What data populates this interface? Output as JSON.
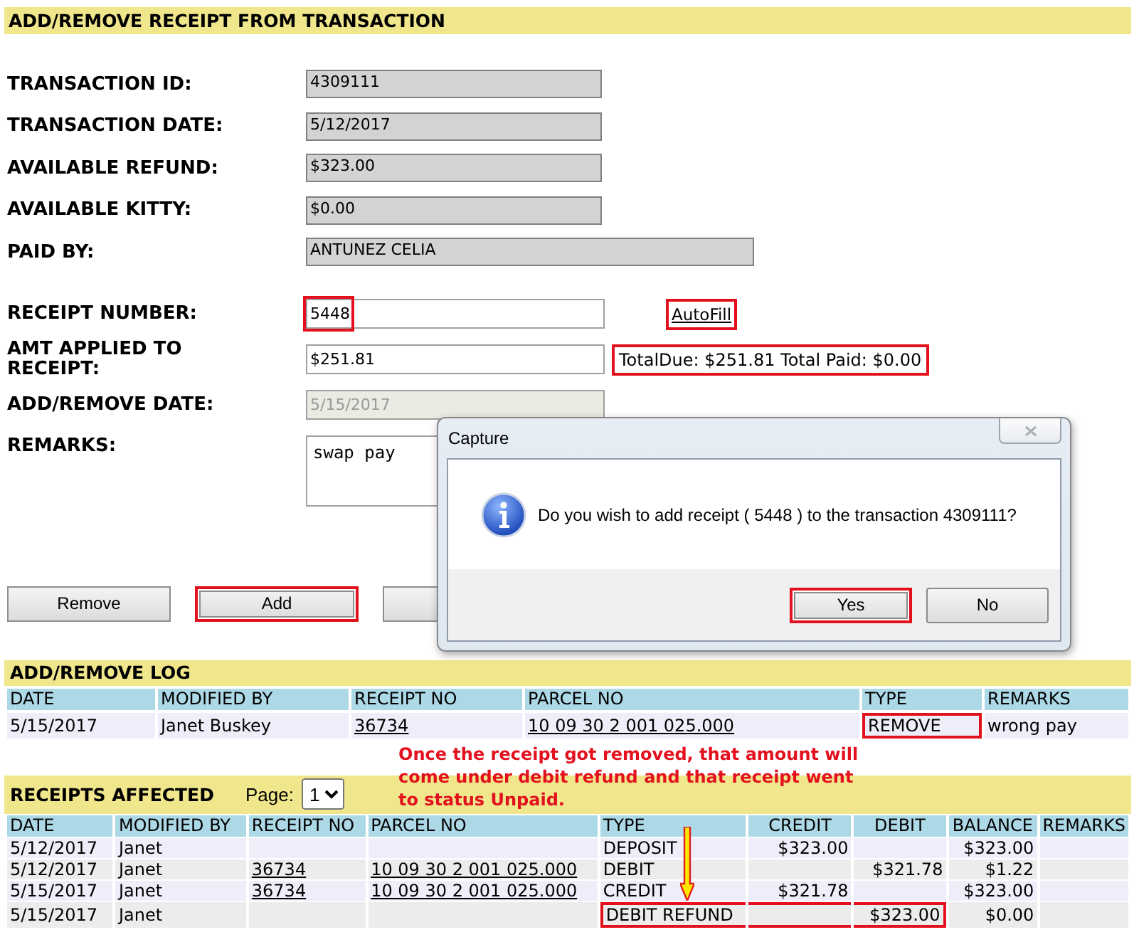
{
  "header": {
    "title": "ADD/REMOVE RECEIPT FROM TRANSACTION"
  },
  "info_fields": [
    {
      "label": "TRANSACTION ID:",
      "value": "4309111"
    },
    {
      "label": "TRANSACTION DATE:",
      "value": "5/12/2017"
    },
    {
      "label": "AVAILABLE REFUND:",
      "value": "$323.00"
    },
    {
      "label": "AVAILABLE KITTY:",
      "value": "$0.00"
    }
  ],
  "paid_by": {
    "label": "PAID BY:",
    "value": "ANTUNEZ CELIA"
  },
  "receipt_number": {
    "label": "RECEIPT NUMBER:",
    "value": "5448",
    "highlighted": true
  },
  "autofill_link": {
    "text": "AutoFill",
    "highlighted": true
  },
  "amount_applied": {
    "label": "AMT APPLIED TO RECEIPT:",
    "value": "$251.81"
  },
  "totals": {
    "text": "TotalDue: $251.81 Total Paid:  $0.00",
    "highlighted": true
  },
  "add_remove_date": {
    "label": "ADD/REMOVE DATE:",
    "value": "5/15/2017",
    "disabled": true
  },
  "remarks": {
    "label": "REMARKS:",
    "value": "swap pay"
  },
  "buttons": [
    {
      "label": "Remove",
      "highlighted": false
    },
    {
      "label": "Add",
      "highlighted": true
    },
    {
      "highlighted": false
    }
  ],
  "dialog": {
    "title": "Capture",
    "message": "Do you wish to add receipt ( 5448 ) to the transaction 4309111?",
    "buttons": [
      {
        "label": "Yes",
        "highlighted": true
      },
      {
        "label": "No",
        "highlighted": false
      }
    ]
  },
  "log": {
    "title": "ADD/REMOVE LOG",
    "columns": [
      {
        "label": "DATE",
        "kind": "text"
      },
      {
        "label": "MODIFIED BY",
        "kind": "text"
      },
      {
        "label": "RECEIPT NO",
        "kind": "link"
      },
      {
        "label": "PARCEL NO",
        "kind": "link"
      },
      {
        "label": "TYPE",
        "kind": "text"
      },
      {
        "label": "REMARKS",
        "kind": "text"
      }
    ],
    "rows": [
      {
        "cells": [
          "5/15/2017",
          "Janet Buskey",
          "36734",
          "10 09 30 2 001 025.000",
          "REMOVE",
          "wrong pay"
        ],
        "highlighted": true
      }
    ]
  },
  "note": {
    "text": "Once the receipt got removed, that amount will\ncome under debit refund and that receipt went\nto status Unpaid."
  },
  "receipts": {
    "title": "RECEIPTS AFFECTED",
    "page_label": "Page:",
    "page_value": "1",
    "columns": [
      {
        "label": "DATE",
        "kind": "text"
      },
      {
        "label": "MODIFIED BY",
        "kind": "text"
      },
      {
        "label": "RECEIPT NO",
        "kind": "link"
      },
      {
        "label": "PARCEL NO",
        "kind": "link"
      },
      {
        "label": "TYPE",
        "kind": "text"
      },
      {
        "label": "CREDIT",
        "kind": "money"
      },
      {
        "label": "DEBIT",
        "kind": "money"
      },
      {
        "label": "BALANCE",
        "kind": "money"
      },
      {
        "label": "REMARKS",
        "kind": "text"
      }
    ],
    "rows": [
      {
        "cells": [
          "5/12/2017",
          "Janet",
          null,
          null,
          "DEPOSIT",
          "$323.00",
          null,
          "$323.00",
          null
        ],
        "highlighted": false
      },
      {
        "cells": [
          "5/12/2017",
          "Janet",
          "36734",
          "10 09 30 2 001 025.000",
          "DEBIT",
          null,
          "$321.78",
          "$1.22",
          null
        ],
        "highlighted": false
      },
      {
        "cells": [
          "5/15/2017",
          "Janet",
          "36734",
          "10 09 30 2 001 025.000",
          "CREDIT",
          "$321.78",
          null,
          "$323.00",
          null
        ],
        "highlighted": false
      },
      {
        "cells": [
          "5/15/2017",
          "Janet",
          null,
          null,
          "DEBIT REFUND",
          null,
          "$323.00",
          "$0.00",
          null
        ],
        "highlighted": true
      }
    ]
  }
}
